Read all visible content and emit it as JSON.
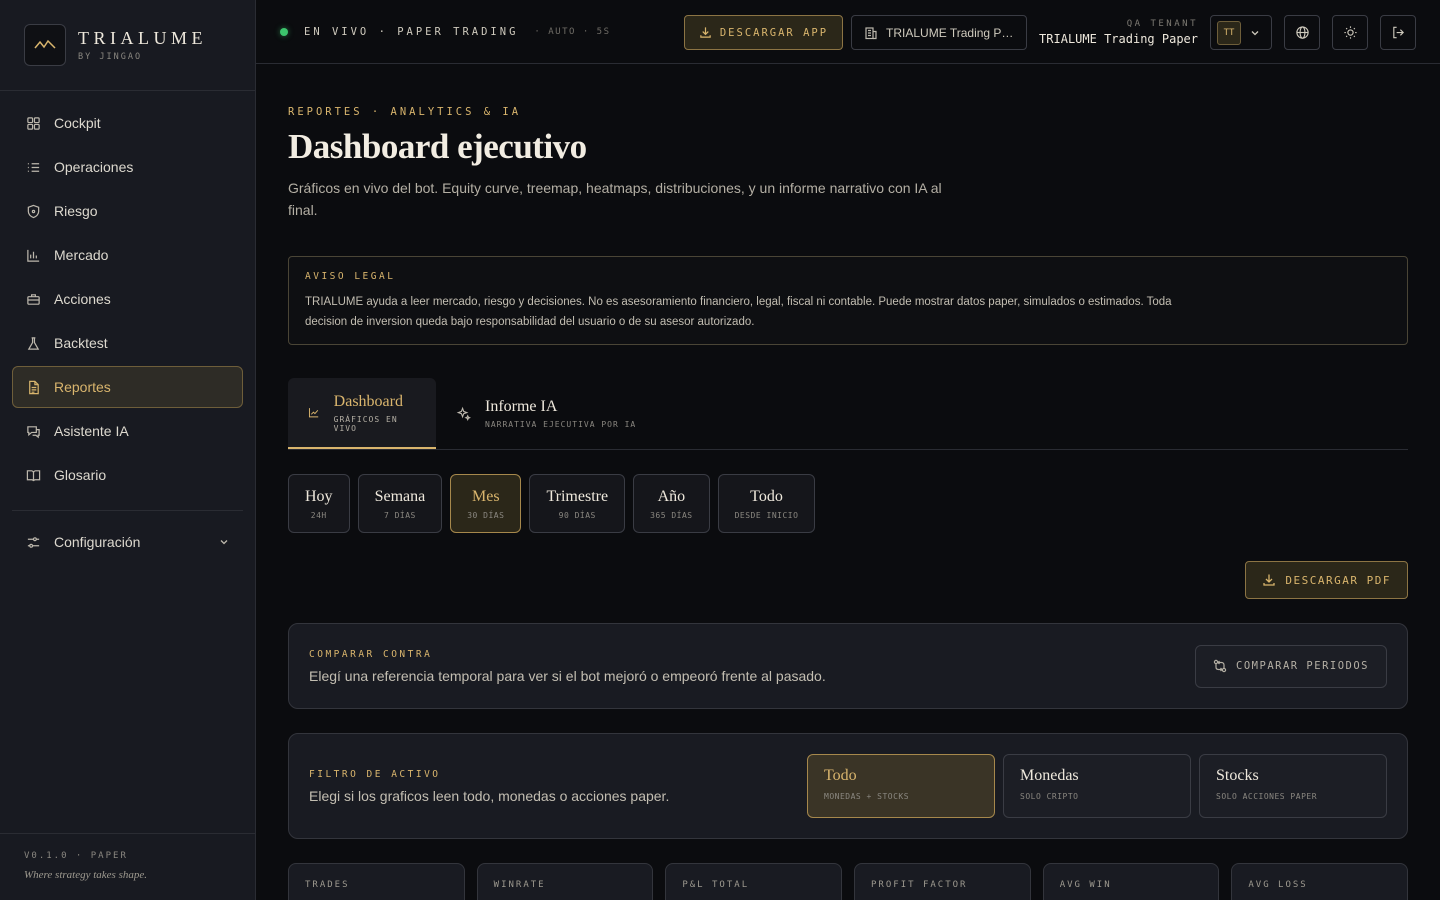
{
  "brand": {
    "name": "TRIALUME",
    "sub": "BY JINGAO"
  },
  "sidebar": {
    "items": [
      {
        "label": "Cockpit",
        "icon": "grid-icon"
      },
      {
        "label": "Operaciones",
        "icon": "list-icon"
      },
      {
        "label": "Riesgo",
        "icon": "shield-icon"
      },
      {
        "label": "Mercado",
        "icon": "bar-chart-icon"
      },
      {
        "label": "Acciones",
        "icon": "briefcase-icon"
      },
      {
        "label": "Backtest",
        "icon": "flask-icon"
      },
      {
        "label": "Reportes",
        "icon": "file-icon",
        "active": true
      },
      {
        "label": "Asistente IA",
        "icon": "chat-icon"
      },
      {
        "label": "Glosario",
        "icon": "book-icon"
      }
    ],
    "config": "Configuración",
    "version": "V0.1.0 · PAPER",
    "tagline": "Where strategy takes shape."
  },
  "topbar": {
    "live": "EN VIVO · PAPER TRADING",
    "auto": "· AUTO · 5S",
    "download": "DESCARGAR APP",
    "tenant_select": "TRIALUME Trading Paper",
    "tenant_label": "QA TENANT",
    "tenant_name": "TRIALUME Trading Paper",
    "avatar": "TT"
  },
  "page": {
    "eyebrow": "REPORTES · ANALYTICS & IA",
    "title": "Dashboard ejecutivo",
    "desc": "Gráficos en vivo del bot. Equity curve, treemap, heatmaps, distribuciones, y un informe narrativo con IA al final."
  },
  "legal": {
    "title": "AVISO LEGAL",
    "text": "TRIALUME ayuda a leer mercado, riesgo y decisiones. No es asesoramiento financiero, legal, fiscal ni contable. Puede mostrar datos paper, simulados o estimados. Toda decision de inversion queda bajo responsabilidad del usuario o de su asesor autorizado."
  },
  "tabs": [
    {
      "label": "Dashboard",
      "sub": "GRÁFICOS EN VIVO"
    },
    {
      "label": "Informe IA",
      "sub": "NARRATIVA EJECUTIVA POR IA"
    }
  ],
  "periods": [
    {
      "label": "Hoy",
      "sub": "24H"
    },
    {
      "label": "Semana",
      "sub": "7 DÍAS"
    },
    {
      "label": "Mes",
      "sub": "30 DÍAS"
    },
    {
      "label": "Trimestre",
      "sub": "90 DÍAS"
    },
    {
      "label": "Año",
      "sub": "365 DÍAS"
    },
    {
      "label": "Todo",
      "sub": "DESDE INICIO"
    }
  ],
  "pdf": "DESCARGAR PDF",
  "compare": {
    "eyebrow": "COMPARAR CONTRA",
    "desc": "Elegí una referencia temporal para ver si el bot mejoró o empeoró frente al pasado.",
    "button": "COMPARAR PERIODOS"
  },
  "filter": {
    "eyebrow": "FILTRO DE ACTIVO",
    "desc": "Elegi si los graficos leen todo, monedas o acciones paper.",
    "options": [
      {
        "label": "Todo",
        "sub": "MONEDAS + STOCKS"
      },
      {
        "label": "Monedas",
        "sub": "SOLO CRIPTO"
      },
      {
        "label": "Stocks",
        "sub": "SOLO ACCIONES PAPER"
      }
    ]
  },
  "kpis": [
    "TRADES",
    "WINRATE",
    "P&L TOTAL",
    "PROFIT FACTOR",
    "AVG WIN",
    "AVG LOSS"
  ],
  "colors": {
    "accent": "#d9b56d",
    "live": "#3cc46c",
    "bg": "#0b0c0f",
    "panel": "#181a21"
  }
}
